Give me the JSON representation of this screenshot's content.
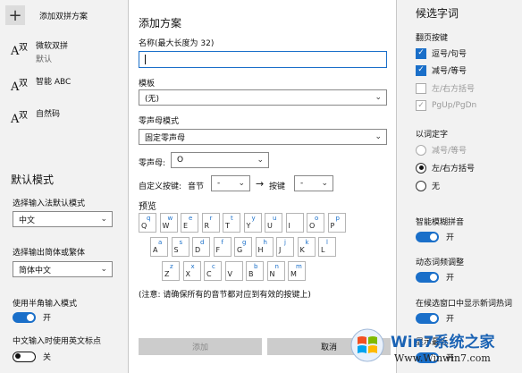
{
  "left": {
    "add_label": "添加双拼方案",
    "schemes": [
      {
        "glyph_a": "A",
        "glyph_z": "双",
        "name": "微软双拼",
        "sub": "默认"
      },
      {
        "glyph_a": "A",
        "glyph_z": "双",
        "name": "智能 ABC",
        "sub": ""
      },
      {
        "glyph_a": "A",
        "glyph_z": "双",
        "name": "自然码",
        "sub": ""
      }
    ],
    "default_mode_title": "默认模式",
    "input_default_label": "选择输入法默认模式",
    "input_default_value": "中文",
    "output_label": "选择输出简体或繁体",
    "output_value": "简体中文",
    "halfwidth_label": "使用半角输入模式",
    "halfwidth_state": "开",
    "english_punct_label": "中文输入时使用英文标点",
    "english_punct_state": "关"
  },
  "dialog": {
    "title": "添加方案",
    "name_label": "名称(最大长度为 32)",
    "name_value": "",
    "template_label": "模板",
    "template_value": "(无)",
    "zero_initial_label": "零声母模式",
    "zero_initial_value": "固定零声母",
    "zero_key_label": "零声母:",
    "zero_key_value": "O",
    "custom_key_label": "自定义按键:",
    "syllable_label": "音节",
    "syllable_value": "-",
    "arrow": "→",
    "key_label": "按键",
    "key_value": "-",
    "preview_label": "预览",
    "keyboard": {
      "row1": [
        {
          "l": "Q",
          "s": "q"
        },
        {
          "l": "W",
          "s": "w"
        },
        {
          "l": "E",
          "s": "e"
        },
        {
          "l": "R",
          "s": "r"
        },
        {
          "l": "T",
          "s": "t"
        },
        {
          "l": "Y",
          "s": "y"
        },
        {
          "l": "U",
          "s": "u"
        },
        {
          "l": "I",
          "s": ""
        },
        {
          "l": "O",
          "s": "o"
        },
        {
          "l": "P",
          "s": "p"
        }
      ],
      "row2": [
        {
          "l": "A",
          "s": "a"
        },
        {
          "l": "S",
          "s": "s"
        },
        {
          "l": "D",
          "s": "d"
        },
        {
          "l": "F",
          "s": "f"
        },
        {
          "l": "G",
          "s": "g"
        },
        {
          "l": "H",
          "s": "h"
        },
        {
          "l": "J",
          "s": "j"
        },
        {
          "l": "K",
          "s": "k"
        },
        {
          "l": "L",
          "s": "l"
        }
      ],
      "row3": [
        {
          "l": "Z",
          "s": "z"
        },
        {
          "l": "X",
          "s": "x"
        },
        {
          "l": "C",
          "s": "c"
        },
        {
          "l": "V",
          "s": ""
        },
        {
          "l": "B",
          "s": "b"
        },
        {
          "l": "N",
          "s": "n"
        },
        {
          "l": "M",
          "s": "m"
        }
      ]
    },
    "note": "(注意: 请确保所有的音节都对应到有效的按键上)",
    "add_button": "添加",
    "cancel_button": "取消"
  },
  "right": {
    "title": "候选字词",
    "page_keys_label": "翻页按键",
    "opt_comma": "逗号/句号",
    "opt_minus": "减号/等号",
    "opt_bracket": "左/右方括号",
    "opt_pgupdn": "PgUp/PgDn",
    "word_pick_label": "以词定字",
    "radio_minus": "减号/等号",
    "radio_bracket": "左/右方括号",
    "radio_none": "无",
    "fuzzy_label": "智能模糊拼音",
    "fuzzy_state": "开",
    "dyn_label": "动态词频调整",
    "dyn_state": "开",
    "hot_label": "在候选窗口中显示新词热词",
    "hot_state": "开",
    "partial_label": "显示最近",
    "partial_state": "开"
  },
  "watermark": {
    "brand": "Win7系统之家",
    "site": "Www.Winwin7.com"
  }
}
